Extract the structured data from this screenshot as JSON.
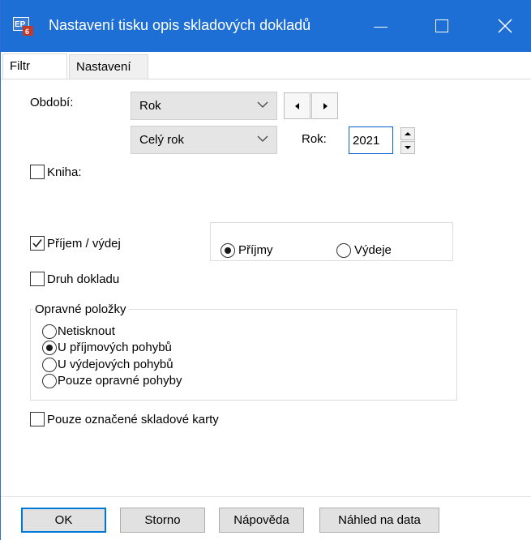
{
  "window": {
    "title": "Nastavení tisku opis skladových dokladů",
    "icon": "app-icon",
    "accent_color": "#1d6fd6"
  },
  "tabs": [
    {
      "label": "Filtr",
      "active": true
    },
    {
      "label": "Nastavení",
      "active": false
    }
  ],
  "period": {
    "label": "Období:",
    "type_value": "Rok",
    "range_value": "Celý rok",
    "year_label": "Rok:",
    "year_value": "2021"
  },
  "kniha": {
    "label": "Kniha:",
    "checked": false
  },
  "prijem_vydej": {
    "label": "Příjem / výdej",
    "checked": true,
    "options": [
      {
        "label": "Příjmy",
        "selected": true
      },
      {
        "label": "Výdeje",
        "selected": false
      }
    ]
  },
  "druh_dokladu": {
    "label": "Druh dokladu",
    "checked": false
  },
  "opravne": {
    "title": "Opravné položky",
    "options": [
      {
        "label": "Netisknout",
        "selected": false
      },
      {
        "label": "U příjmových pohybů",
        "selected": true
      },
      {
        "label": "U výdejových pohybů",
        "selected": false
      },
      {
        "label": "Pouze opravné pohyby",
        "selected": false
      }
    ]
  },
  "pouze_oznacene": {
    "label": "Pouze označené skladové karty",
    "checked": false
  },
  "buttons": {
    "ok": "OK",
    "storno": "Storno",
    "napoveda": "Nápověda",
    "nahled": "Náhled na data"
  }
}
